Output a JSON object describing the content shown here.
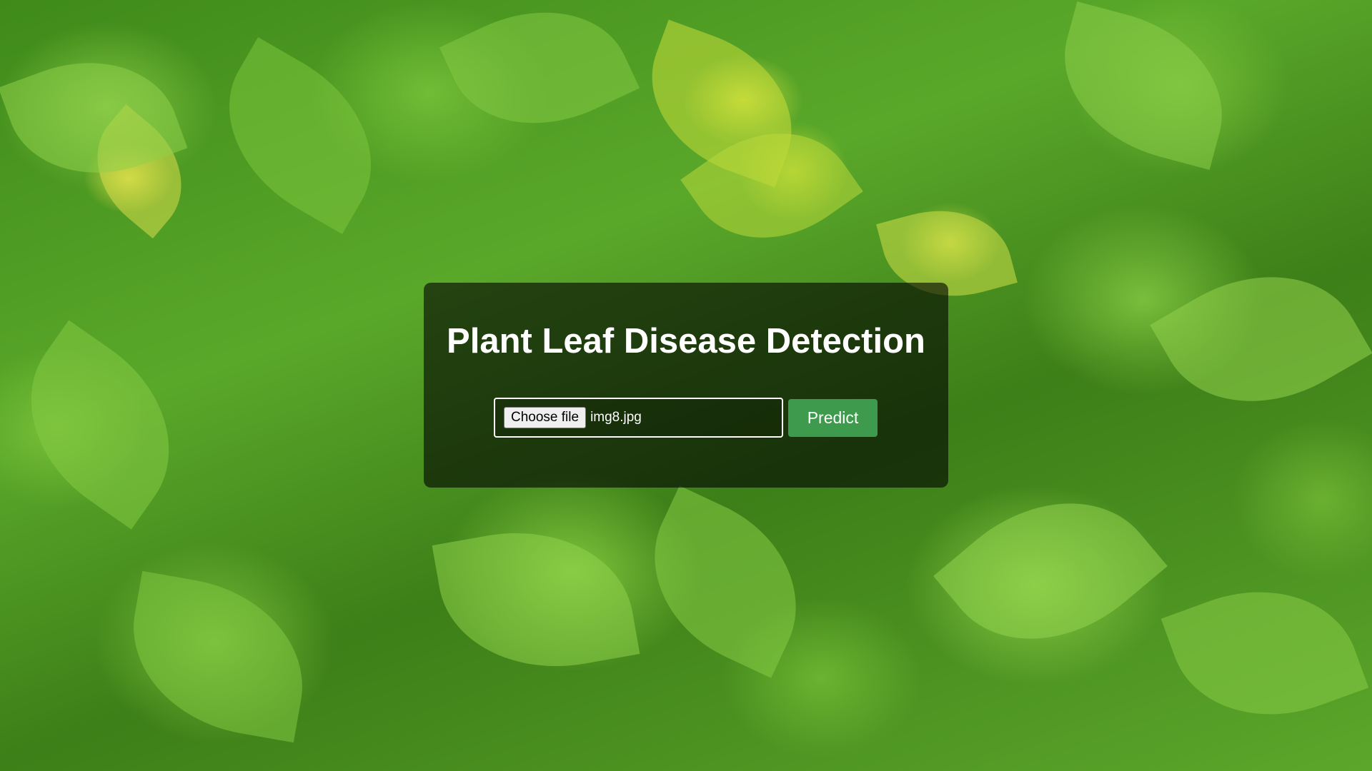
{
  "page": {
    "title": "Plant Leaf Disease Detection",
    "background": "green-leaves-photo"
  },
  "upload_form": {
    "choose_file_label": "Choose file",
    "selected_file": "img8.jpg",
    "predict_label": "Predict"
  },
  "colors": {
    "panel_overlay": "rgba(0,0,0,0.6)",
    "predict_button": "#3e9a4c",
    "title_text": "#ffffff"
  }
}
